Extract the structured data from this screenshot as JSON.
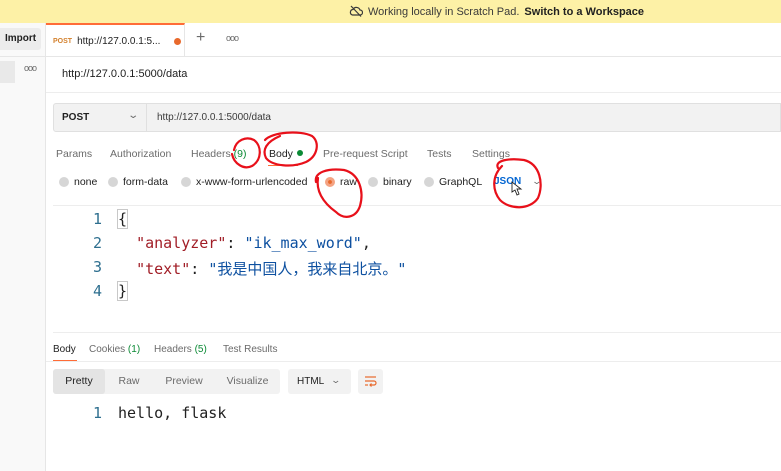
{
  "banner": {
    "icon": "cloud-off-icon",
    "text": "Working locally in Scratch Pad.",
    "link": "Switch to a Workspace"
  },
  "sidebar": {
    "import_label": "Import",
    "more_icon": "ooo"
  },
  "tabs": {
    "items": [
      {
        "method": "POST",
        "title": "http://127.0.0.1:5...",
        "unsaved": true
      }
    ],
    "add_icon": "+",
    "more_icon": "ooo"
  },
  "request": {
    "title": "http://127.0.0.1:5000/data",
    "method": "POST",
    "url": "http://127.0.0.1:5000/data",
    "tabs": [
      {
        "label": "Params"
      },
      {
        "label": "Authorization"
      },
      {
        "label": "Headers",
        "count": "(9)"
      },
      {
        "label": "Body",
        "active": true
      },
      {
        "label": "Pre-request Script"
      },
      {
        "label": "Tests"
      },
      {
        "label": "Settings"
      }
    ],
    "body_types": [
      "none",
      "form-data",
      "x-www-form-urlencoded",
      "raw",
      "binary",
      "GraphQL"
    ],
    "selected_body_type": "raw",
    "raw_format": "JSON",
    "editor": {
      "line_numbers": [
        "1",
        "2",
        "3",
        "4"
      ],
      "open_brace": "{",
      "close_brace": "}",
      "key1": "\"analyzer\"",
      "val1": "\"ik_max_word\"",
      "key2": "\"text\"",
      "val2": "\"我是中国人，我来自北京。\""
    }
  },
  "response": {
    "tabs": [
      {
        "label": "Body",
        "active": true
      },
      {
        "label": "Cookies",
        "count": "(1)"
      },
      {
        "label": "Headers",
        "count": "(5)"
      },
      {
        "label": "Test Results"
      }
    ],
    "views": [
      "Pretty",
      "Raw",
      "Preview",
      "Visualize"
    ],
    "active_view": "Pretty",
    "format": "HTML",
    "body": {
      "line_number": "1",
      "text": "hello, flask"
    }
  },
  "colors": {
    "accent": "#ff6c37",
    "success": "#0b8a35",
    "json_blue": "#0265d2",
    "banner_bg": "#fdf1a6",
    "annotation": "#e8101a"
  }
}
